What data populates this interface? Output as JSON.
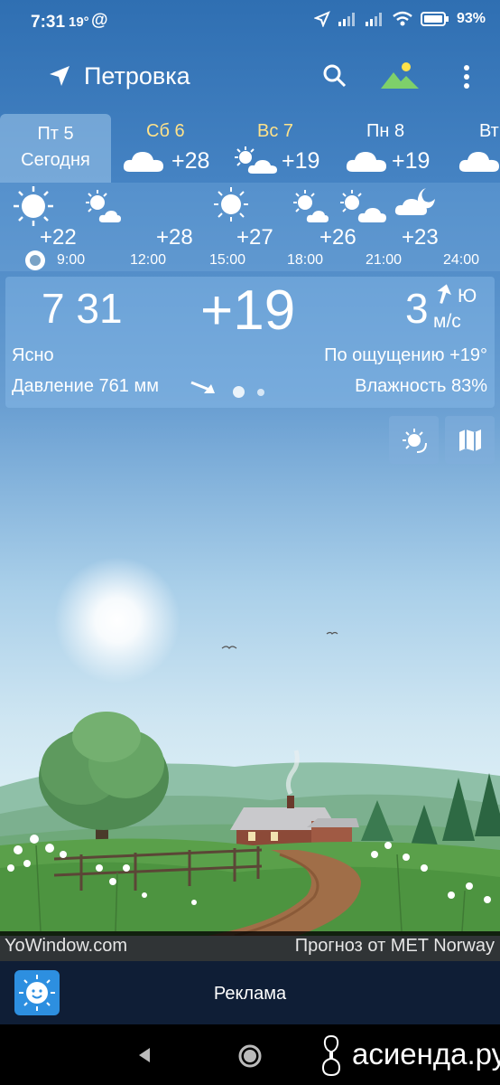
{
  "status": {
    "time": "7:31",
    "temp": "19°",
    "at": "@",
    "battery": "93%"
  },
  "toolbar": {
    "location": "Петровка",
    "icons": [
      "navigation-arrow-icon",
      "search-icon",
      "landscape-icon",
      "more-vert-icon"
    ]
  },
  "days": [
    {
      "name": "Пт 5",
      "subtitle": "Сегодня",
      "selected": true
    },
    {
      "name": "Сб 6",
      "temp": "+28",
      "icon": "cloud-icon",
      "weekend": true
    },
    {
      "name": "Вс 7",
      "temp": "+19",
      "icon": "sun-cloud-icon",
      "weekend": true
    },
    {
      "name": "Пн 8",
      "temp": "+19",
      "icon": "cloud-icon",
      "weekend": false
    },
    {
      "name": "Вт",
      "icon": "cloud-icon",
      "weekend": false
    }
  ],
  "hourly": [
    {
      "time": "9:00",
      "temp": "+22",
      "icon": "sun-icon"
    },
    {
      "time": "12:00",
      "temp": "+28",
      "icon": "sun-cloud-icon"
    },
    {
      "time": "15:00",
      "temp": "+27",
      "icon": "sun-icon"
    },
    {
      "time": "18:00",
      "temp": "+26",
      "icon": "sun-cloud-icon"
    },
    {
      "time": "21:00",
      "temp": "+23",
      "icon": "sun-cloud-icon"
    },
    {
      "time": "24:00",
      "temp": "",
      "icon": "moon-cloud-icon"
    }
  ],
  "current": {
    "time": "7 31",
    "temp": "+19",
    "wind_speed": "3",
    "wind_dir": "Ю",
    "wind_unit": "м/с",
    "condition": "Ясно",
    "feels_like": "По ощущению +19°",
    "pressure": "Давление 761 мм",
    "humidity": "Влажность 83%"
  },
  "footer": {
    "left": "YoWindow.com",
    "right": "Прогноз от MET Norway"
  },
  "ad": {
    "label": "Реклама"
  },
  "watermark": "асиенда.ру",
  "colors": {
    "weekend": "#ffe28a",
    "sky_top": "#2f6fb2",
    "ad_bar": "#0f1e36"
  }
}
